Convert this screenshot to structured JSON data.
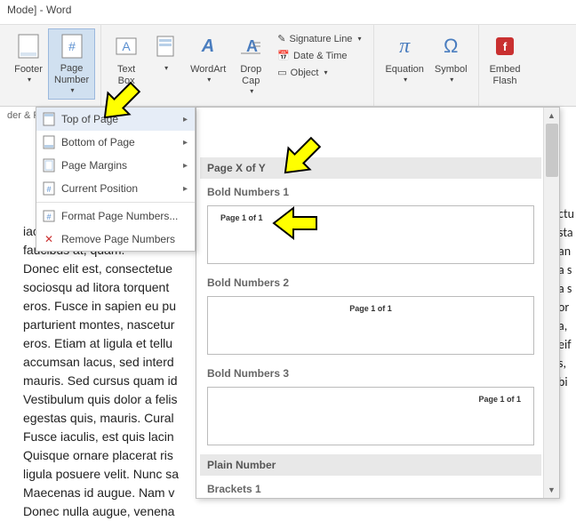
{
  "title": "Mode] - Word",
  "info_bar": "der & F",
  "ribbon": {
    "footer": "Footer",
    "page_number": "Page\nNumber",
    "text_box": "Text\nBox",
    "quick_parts": "",
    "wordart": "WordArt",
    "drop_cap": "Drop\nCap",
    "sig_line": "Signature Line",
    "date_time": "Date & Time",
    "object": "Object",
    "equation": "Equation",
    "symbol": "Symbol",
    "embed_flash": "Embed\nFlash"
  },
  "dropdown": {
    "top_of_page": "Top of Page",
    "bottom_of_page": "Bottom of Page",
    "page_margins": "Page Margins",
    "current_position": "Current Position",
    "format_numbers": "Format Page Numbers...",
    "remove_numbers": "Remove Page Numbers"
  },
  "gallery": {
    "header_xofy": "Page X of Y",
    "bold1": "Bold Numbers 1",
    "bold2": "Bold Numbers 2",
    "bold3": "Bold Numbers 3",
    "plain_header": "Plain Number",
    "brackets1": "Brackets 1",
    "preview_text": "Page 1 of 1"
  },
  "doc": {
    "p1": "iaculis nibh, vitae scelerisq\nfaucibus at, quam.",
    "p2": "Donec elit est, consectetue\nsociosqu ad litora torquent\neros. Fusce in sapien eu pu\nparturient montes, nascetur\neros. Etiam at ligula et tellu\naccumsan lacus, sed interd\nmauris. Sed cursus quam id\nVestibulum quis dolor a felis\negestas quis, mauris. Cural\nFusce iaculis, est quis lacin\nQuisque ornare placerat ris\nligula posuere velit. Nunc sa\nMaecenas id augue. Nam v\nDonec nulla augue, venena",
    "right_text": "ctu\nsta\nan\na s\na s\nor\na,\neif\ns,\nbi"
  }
}
